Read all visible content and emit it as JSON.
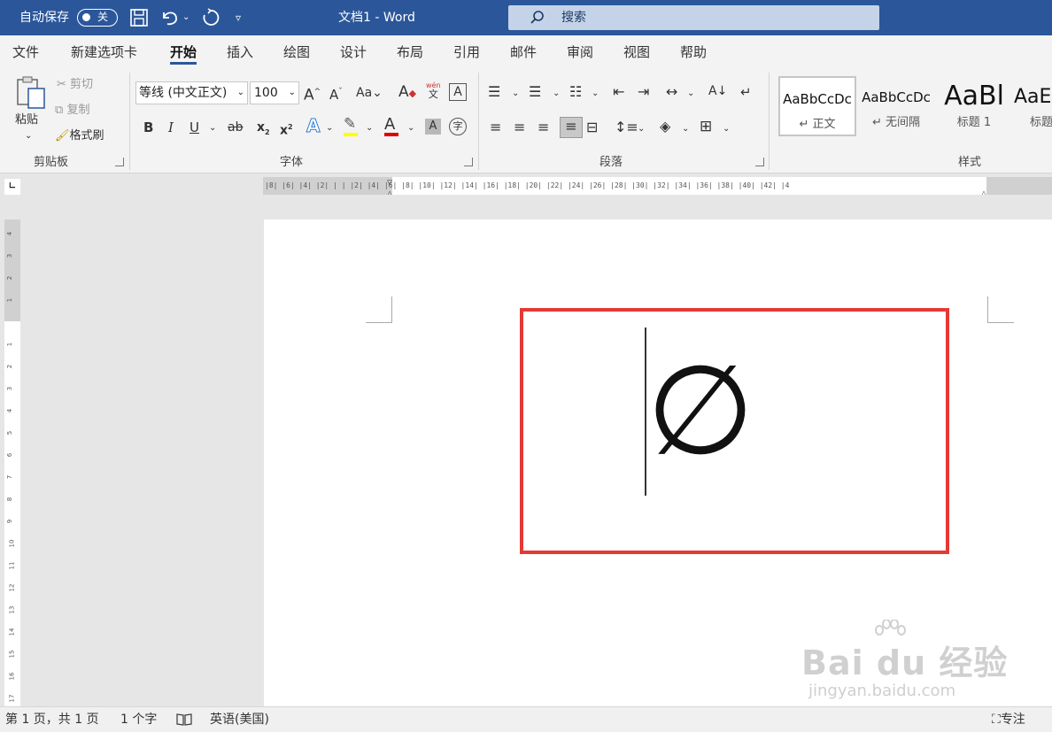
{
  "titlebar": {
    "autosave_label": "自动保存",
    "autosave_state": "关",
    "doc_title": "文档1  -  Word",
    "search_placeholder": "搜索"
  },
  "tabs": [
    {
      "label": "文件"
    },
    {
      "label": "新建选项卡"
    },
    {
      "label": "开始",
      "active": true
    },
    {
      "label": "插入"
    },
    {
      "label": "绘图"
    },
    {
      "label": "设计"
    },
    {
      "label": "布局"
    },
    {
      "label": "引用"
    },
    {
      "label": "邮件"
    },
    {
      "label": "审阅"
    },
    {
      "label": "视图"
    },
    {
      "label": "帮助"
    }
  ],
  "clipboard": {
    "group_label": "剪贴板",
    "paste": "粘贴",
    "cut": "剪切",
    "copy": "复制",
    "format_painter": "格式刷"
  },
  "font": {
    "group_label": "字体",
    "font_name": "等线 (中文正文)",
    "font_size": "100",
    "phonetic_top": "wén",
    "phonetic_bottom": "文",
    "highlight_color": "#ffff00",
    "font_color": "#e00000"
  },
  "paragraph": {
    "group_label": "段落"
  },
  "styles": {
    "group_label": "样式",
    "items": [
      {
        "preview": "AaBbCcDc",
        "name": "↵ 正文"
      },
      {
        "preview": "AaBbCcDc",
        "name": "↵ 无间隔"
      },
      {
        "preview": "AaBl",
        "name": "标题 1"
      },
      {
        "preview": "AaE",
        "name": "标题"
      }
    ]
  },
  "ruler": {
    "text": "|8|  |6|  |4|  |2|  |  |  |2|  |4|  |6|  |8|  |10|  |12|  |14|  |16|  |18|  |20|  |22|  |24|  |26|  |28|  |30|  |32|  |34|  |36|  |38|  |40|  |42|  |4"
  },
  "document": {
    "content": "∅",
    "highlight_color": "#e53935"
  },
  "statusbar": {
    "page_info": "第 1 页，共 1 页",
    "word_count": "1 个字",
    "language": "英语(美国)",
    "focus": "专注"
  },
  "watermark": {
    "brand": "Bai du 经验",
    "url": "jingyan.baidu.com"
  }
}
